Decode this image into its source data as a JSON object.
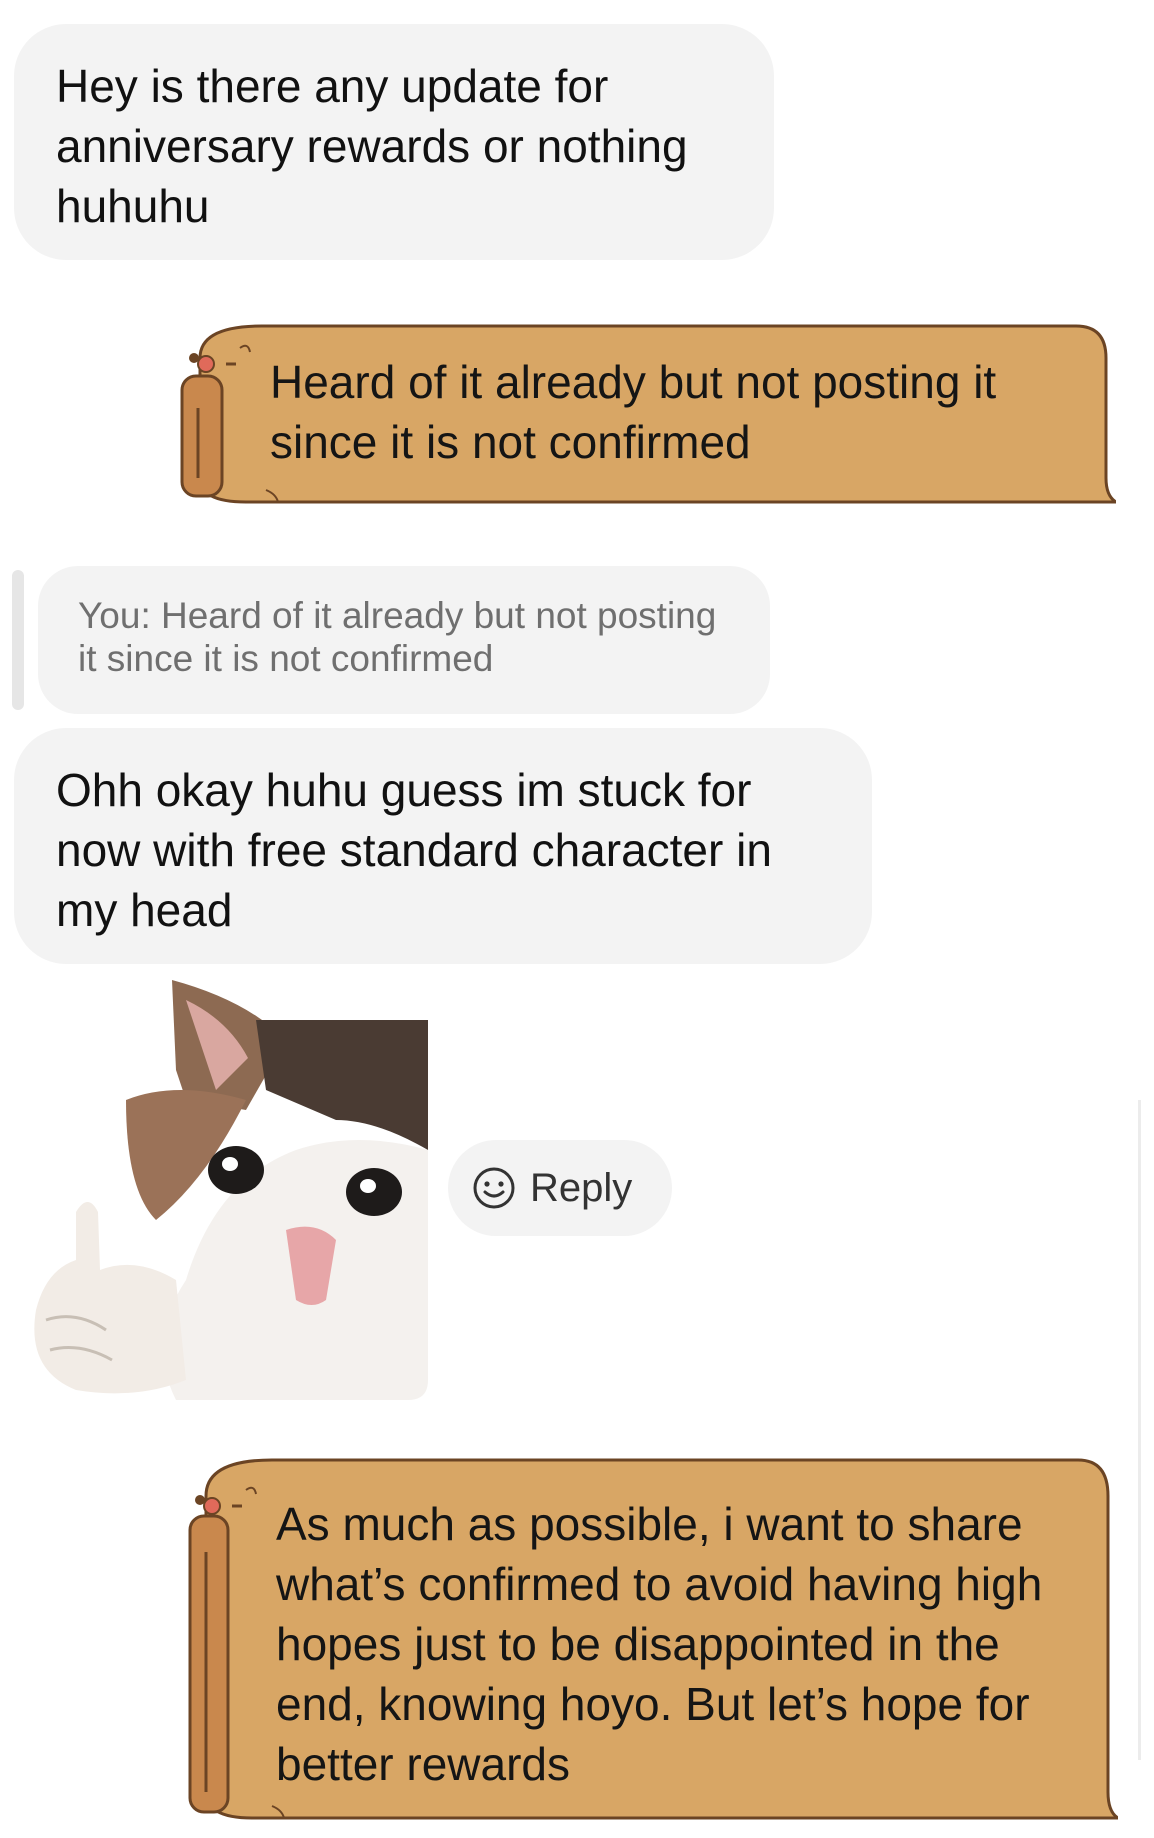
{
  "messages": [
    {
      "sender": "them",
      "text": "Hey is there any update for anniversary rewards or nothing huhuhu"
    },
    {
      "sender": "you",
      "text": "Heard of it already but not posting it since it is not confirmed"
    },
    {
      "sender": "them",
      "quoted": "You: Heard of it already but not posting it since it is not confirmed",
      "text": "Ohh okay huhu guess im stuck for now with free standard character in my head"
    },
    {
      "sender": "them",
      "sticker": "crying-cat-thumbs-up"
    },
    {
      "sender": "you",
      "text": "As much as possible, i want to share what’s confirmed to avoid having high hopes just to be disappointed in the end, knowing hoyo. But let’s hope for better rewards"
    }
  ],
  "reply_button": {
    "label": "Reply",
    "icon": "smiley-icon"
  },
  "colors": {
    "incoming_bubble": "#f3f3f3",
    "outgoing_scroll": "#d8a665",
    "scroll_roll": "#c9884d",
    "scroll_outline": "#6b4424",
    "quote_text": "#6f6f6f"
  }
}
